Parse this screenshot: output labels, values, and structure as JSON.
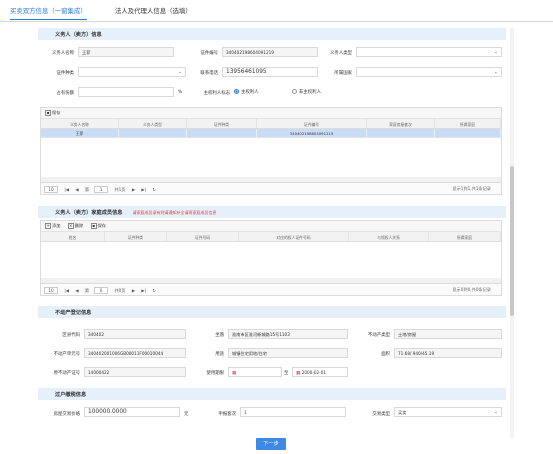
{
  "tabs": [
    "买卖双方信息（一窗集成）",
    "法人及代理人信息（选填）"
  ],
  "obligor": {
    "section_title": "义务人（卖方）信息",
    "name_label": "义务人名称",
    "name_value": "王菲",
    "cert_no_label": "证件编号",
    "cert_no_value": "340402198604091219",
    "type_label": "义务人类型",
    "type_value": "",
    "cert_type_label": "证件种类",
    "cert_type_value": "",
    "phone_label": "联系电话",
    "phone_value": "13956461095",
    "country_label": "所属国家",
    "country_value": "",
    "share_label": "占有份额",
    "share_unit": "%",
    "is_rightholder_label": "主权利人标志",
    "radio_yes": "主权利人",
    "radio_no": "非主权利人",
    "save_label": "保存",
    "columns": [
      "义务人名称",
      "义务人类型",
      "证件种类",
      "证件编号",
      "家庭房屋套次",
      "所属家庭"
    ],
    "rows": [
      [
        "王菲",
        "",
        "",
        "340402198604091219",
        "",
        ""
      ]
    ],
    "pager": {
      "first": "|◀",
      "prev": "◀",
      "page_label": "第",
      "page": "1",
      "total": "共1页",
      "next": "▶",
      "last": "▶|",
      "refresh": "↻",
      "size": "10",
      "info": "显示1到1,共1条记录"
    }
  },
  "family": {
    "section_title": "义务人（卖方）家庭成员信息",
    "warning": "请家庭成员录有则请通知补全请再家庭成员信息",
    "add_label": "添加",
    "delete_label": "删除",
    "save_label": "保存",
    "columns": [
      "姓名",
      "证件种类",
      "证件号码",
      "对应的权人证件号码",
      "与领权人关系",
      "所属家庭"
    ],
    "pager": {
      "first": "|◀",
      "prev": "◀",
      "page_label": "第",
      "page": "0",
      "total": "共0页",
      "next": "▶",
      "last": "▶|",
      "refresh": "↻",
      "size": "10",
      "info": "显示0到0,共0条记录"
    }
  },
  "property": {
    "section_title": "不动产登记信息",
    "area_code_label": "区县代码",
    "area_code_value": "340402",
    "location_label": "坐落",
    "location_value": "淮南市区淮河新城路15号1103",
    "type_label": "不动产类型",
    "type_value": "土地/房屋",
    "unit_no_label": "不动产单元号",
    "unit_no_value": "340402001006GB00011F00010044",
    "use_label": "用途",
    "use_value": "城镇住宅用地/住宅",
    "area_label": "面积",
    "area_value": "71.68/ 940/45.19",
    "cert_label": "原不动产证号",
    "cert_value": "14000422",
    "period_label": "使用期限",
    "period_to": "至",
    "period_end": "2000-02-01"
  },
  "transfer": {
    "section_title": "过户缴税信息",
    "price_label": "房屋交易价格",
    "price_value": "100000.0000",
    "price_unit": "元",
    "count_label": "申报套次",
    "count_value": "1",
    "trade_type_label": "交易类型",
    "trade_type_value": "买卖"
  },
  "next_label": "下一步",
  "colors": {
    "accent": "#2e7cd6",
    "section_bg": "#e6f0fb",
    "selected_row": "#c9dcf6",
    "warning": "#e53935"
  }
}
